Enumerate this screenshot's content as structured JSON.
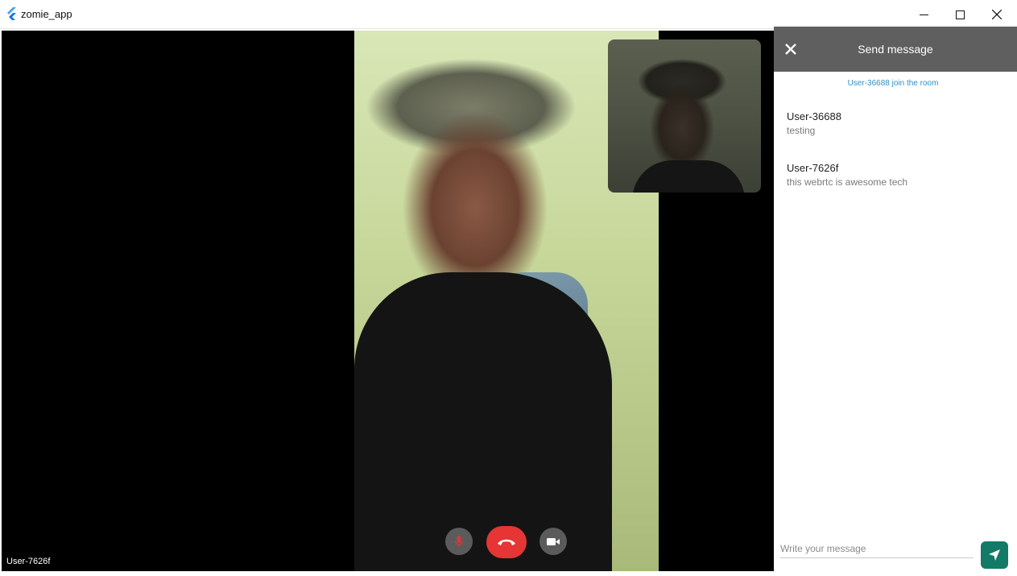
{
  "window": {
    "title": "zomie_app",
    "icons": {
      "logo": "flutter-logo-icon",
      "minimize": "minimize-icon",
      "maximize": "maximize-icon",
      "close": "close-icon"
    }
  },
  "video": {
    "remote_user_label": "User-7626f",
    "controls": {
      "mic_icon": "mic-off-icon",
      "end_icon": "phone-hangup-icon",
      "camera_icon": "video-camera-icon",
      "end_color": "#e53535"
    }
  },
  "chat": {
    "header_title": "Send message",
    "close_icon": "close-icon",
    "notice": "User-36688 join the room",
    "notice_color": "#2f8fc9",
    "messages": [
      {
        "user": "User-36688",
        "text": "testing"
      },
      {
        "user": "User-7626f",
        "text": "this webrtc is awesome tech"
      }
    ],
    "input": {
      "placeholder": "Write your message",
      "value": ""
    },
    "send_icon": "send-icon",
    "send_color": "#127a66"
  }
}
